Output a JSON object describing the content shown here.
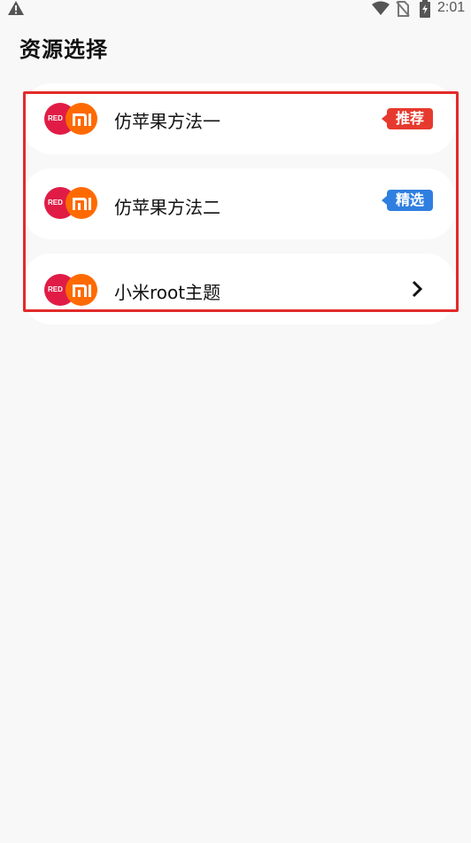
{
  "status_bar": {
    "time": "2:01",
    "icons": [
      "warning-icon",
      "wifi-icon",
      "no-sim-icon",
      "battery-charging-icon"
    ]
  },
  "page": {
    "title": "资源选择"
  },
  "items": [
    {
      "label": "仿苹果方法一",
      "logo_left": "RED",
      "badge": "推荐",
      "badge_color": "#e63a2e"
    },
    {
      "label": "仿苹果方法二",
      "logo_left": "RED",
      "badge": "精选",
      "badge_color": "#2f7fe0"
    },
    {
      "label": "小米root主题",
      "logo_left": "RED",
      "trailing_icon": "chevron-right-icon"
    }
  ],
  "colors": {
    "background": "#f8f8f8",
    "card": "#ffffff",
    "highlight": "#e22a2a",
    "redmi_red": "#e01c46",
    "mi_orange": "#ff6a00"
  }
}
